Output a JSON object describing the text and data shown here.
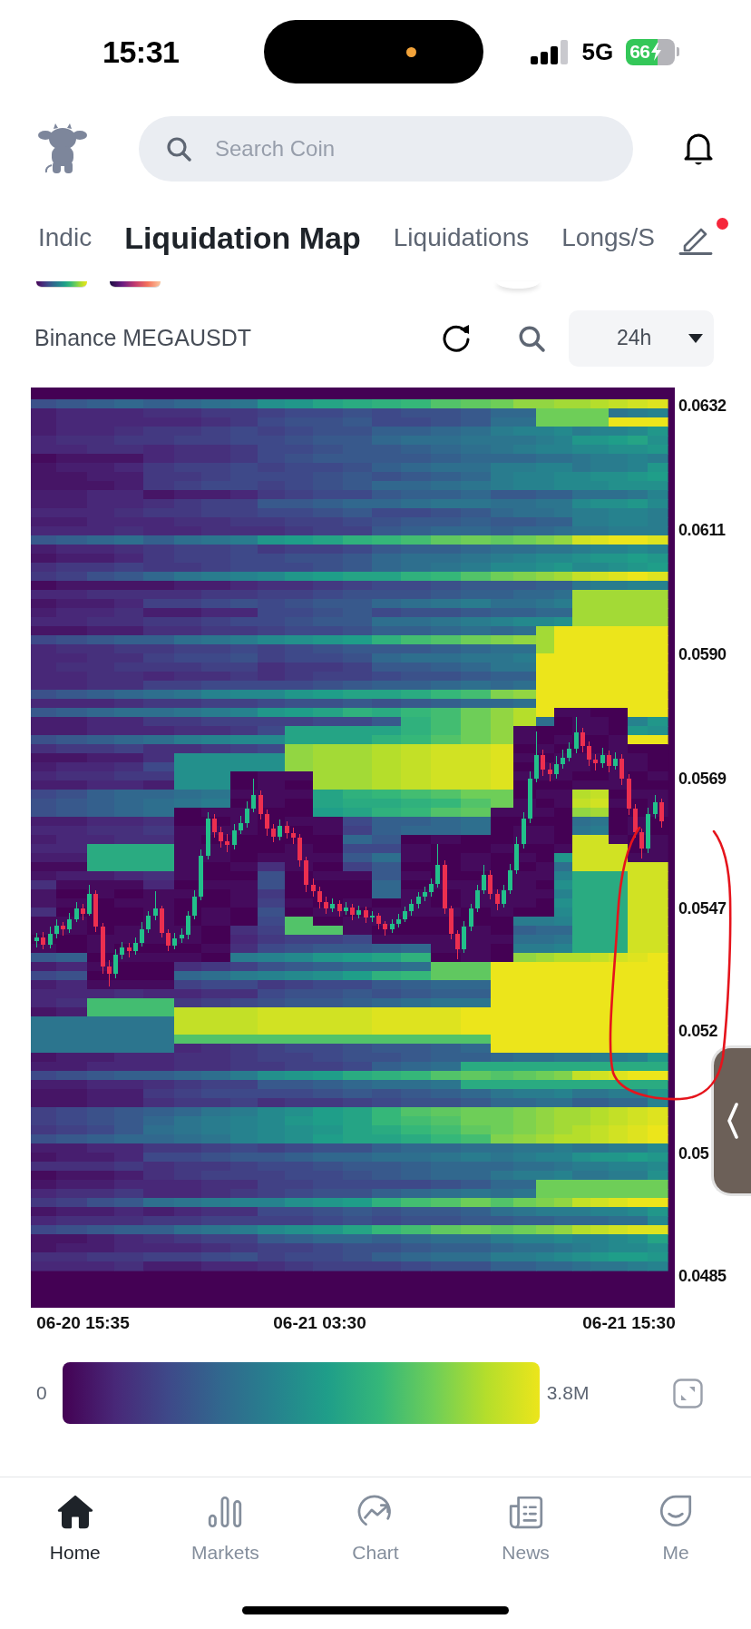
{
  "status_bar": {
    "time": "15:31",
    "network": "5G",
    "battery": "66",
    "charging": true
  },
  "header": {
    "search": {
      "placeholder": "Search Coin"
    }
  },
  "tabs": [
    {
      "label": "Indic",
      "selected": false
    },
    {
      "label": "Liquidation Map",
      "selected": true
    },
    {
      "label": "Liquidations",
      "selected": false
    },
    {
      "label": "Longs/S",
      "selected": false
    }
  ],
  "edit": {
    "notification": true
  },
  "toolbar": {
    "pair": "Binance MEGAUSDT",
    "interval": "24h"
  },
  "chart": {
    "chart_data": {
      "type": "candlestick",
      "categories": [
        null,
        null,
        null,
        null,
        null,
        null,
        null,
        "06-20 15:35",
        null,
        null,
        null,
        null,
        null,
        null,
        null,
        null,
        null,
        null,
        null,
        null,
        null,
        null,
        null,
        null,
        null,
        null,
        null,
        null,
        null,
        null,
        null,
        null,
        null,
        null,
        null,
        null,
        null,
        null,
        null,
        null,
        null,
        null,
        null,
        "06-21 03:30",
        null,
        null,
        null,
        null,
        null,
        null,
        null,
        null,
        null,
        null,
        null,
        null,
        null,
        null,
        null,
        null,
        null,
        null,
        null,
        null,
        null,
        null,
        null,
        null,
        null,
        null,
        null,
        null,
        null,
        null,
        null,
        null,
        null,
        null,
        null,
        null,
        null,
        null,
        null,
        null,
        null,
        null,
        null,
        null,
        null,
        null,
        "06-21 15:30",
        null,
        null,
        null,
        null,
        null
      ],
      "ohlc": [
        [
          0.05415,
          0.0543,
          0.05405,
          0.05422
        ],
        [
          0.05422,
          0.05431,
          0.05402,
          0.0541
        ],
        [
          0.0541,
          0.0544,
          0.05404,
          0.05428
        ],
        [
          0.05428,
          0.05452,
          0.0542,
          0.05441
        ],
        [
          0.05441,
          0.05448,
          0.05425,
          0.05436
        ],
        [
          0.05436,
          0.05463,
          0.0543,
          0.05452
        ],
        [
          0.05452,
          0.05481,
          0.05447,
          0.0547
        ],
        [
          0.0547,
          0.05478,
          0.05451,
          0.05462
        ],
        [
          0.05462,
          0.05511,
          0.05458,
          0.05496
        ],
        [
          0.05496,
          0.05502,
          0.05431,
          0.0544
        ],
        [
          0.0544,
          0.05446,
          0.05361,
          0.05372
        ],
        [
          0.05372,
          0.05384,
          0.05339,
          0.0536
        ],
        [
          0.0536,
          0.05401,
          0.05352,
          0.05392
        ],
        [
          0.05392,
          0.05414,
          0.05385,
          0.05405
        ],
        [
          0.05405,
          0.05412,
          0.05388,
          0.05398
        ],
        [
          0.05398,
          0.05421,
          0.05392,
          0.05412
        ],
        [
          0.05412,
          0.05447,
          0.05406,
          0.05436
        ],
        [
          0.05436,
          0.05466,
          0.0543,
          0.05458
        ],
        [
          0.05458,
          0.055,
          0.05451,
          0.0547
        ],
        [
          0.0547,
          0.05476,
          0.05421,
          0.0543
        ],
        [
          0.0543,
          0.05436,
          0.05398,
          0.05408
        ],
        [
          0.05408,
          0.05429,
          0.05401,
          0.0542
        ],
        [
          0.0542,
          0.05437,
          0.05412,
          0.05426
        ],
        [
          0.05426,
          0.05466,
          0.05419,
          0.05458
        ],
        [
          0.05458,
          0.05501,
          0.05452,
          0.0549
        ],
        [
          0.0549,
          0.05571,
          0.05484,
          0.0556
        ],
        [
          0.0556,
          0.05634,
          0.05553,
          0.05622
        ],
        [
          0.05622,
          0.0563,
          0.0559,
          0.056
        ],
        [
          0.056,
          0.05609,
          0.05574,
          0.05585
        ],
        [
          0.05585,
          0.05596,
          0.05566,
          0.05578
        ],
        [
          0.05578,
          0.05613,
          0.05571,
          0.05602
        ],
        [
          0.05602,
          0.05627,
          0.05596,
          0.05615
        ],
        [
          0.05615,
          0.05652,
          0.05608,
          0.0564
        ],
        [
          0.0564,
          0.0569,
          0.05633,
          0.05662
        ],
        [
          0.05662,
          0.0567,
          0.05621,
          0.0563
        ],
        [
          0.0563,
          0.05638,
          0.05594,
          0.05605
        ],
        [
          0.05605,
          0.05614,
          0.05582,
          0.05592
        ],
        [
          0.05592,
          0.05621,
          0.05586,
          0.0561
        ],
        [
          0.0561,
          0.05618,
          0.05589,
          0.05598
        ],
        [
          0.05598,
          0.05607,
          0.05579,
          0.0559
        ],
        [
          0.0559,
          0.05596,
          0.05541,
          0.05552
        ],
        [
          0.05552,
          0.05558,
          0.05499,
          0.0551
        ],
        [
          0.0551,
          0.05521,
          0.0549,
          0.055
        ],
        [
          0.055,
          0.05508,
          0.05471,
          0.05482
        ],
        [
          0.05482,
          0.05491,
          0.05461,
          0.0547
        ],
        [
          0.0547,
          0.05487,
          0.05464,
          0.05478
        ],
        [
          0.05478,
          0.05484,
          0.05457,
          0.05466
        ],
        [
          0.05466,
          0.05481,
          0.0546,
          0.05472
        ],
        [
          0.05472,
          0.05479,
          0.05451,
          0.0546
        ],
        [
          0.0546,
          0.05476,
          0.05454,
          0.05468
        ],
        [
          0.05468,
          0.05474,
          0.05446,
          0.05455
        ],
        [
          0.05455,
          0.05466,
          0.05448,
          0.05458
        ],
        [
          0.05458,
          0.05463,
          0.05435,
          0.05444
        ],
        [
          0.05444,
          0.0545,
          0.05424,
          0.05436
        ],
        [
          0.05436,
          0.05453,
          0.0543,
          0.05445
        ],
        [
          0.05445,
          0.05461,
          0.05439,
          0.05452
        ],
        [
          0.05452,
          0.05474,
          0.05447,
          0.05466
        ],
        [
          0.05466,
          0.05486,
          0.05459,
          0.05478
        ],
        [
          0.05478,
          0.05499,
          0.05471,
          0.0549
        ],
        [
          0.0549,
          0.05508,
          0.05483,
          0.05498
        ],
        [
          0.05498,
          0.05521,
          0.05491,
          0.05512
        ],
        [
          0.05512,
          0.0558,
          0.05506,
          0.05545
        ],
        [
          0.05545,
          0.05552,
          0.05462,
          0.0547
        ],
        [
          0.0547,
          0.05476,
          0.05418,
          0.05428
        ],
        [
          0.05428,
          0.05434,
          0.05385,
          0.05402
        ],
        [
          0.05402,
          0.05449,
          0.05396,
          0.0544
        ],
        [
          0.0544,
          0.05479,
          0.05433,
          0.0547
        ],
        [
          0.0547,
          0.05511,
          0.05464,
          0.05502
        ],
        [
          0.05502,
          0.05545,
          0.05496,
          0.05528
        ],
        [
          0.05528,
          0.05535,
          0.05486,
          0.05495
        ],
        [
          0.05495,
          0.05503,
          0.05468,
          0.05478
        ],
        [
          0.05478,
          0.05511,
          0.05472,
          0.05502
        ],
        [
          0.05502,
          0.05546,
          0.05495,
          0.05535
        ],
        [
          0.05535,
          0.05592,
          0.05529,
          0.0558
        ],
        [
          0.0558,
          0.05633,
          0.05572,
          0.05622
        ],
        [
          0.05622,
          0.05702,
          0.05615,
          0.0569
        ],
        [
          0.0569,
          0.0577,
          0.05684,
          0.0573
        ],
        [
          0.0573,
          0.05739,
          0.05694,
          0.05705
        ],
        [
          0.05705,
          0.05716,
          0.05686,
          0.05698
        ],
        [
          0.05698,
          0.05728,
          0.0569,
          0.05715
        ],
        [
          0.05715,
          0.05739,
          0.05707,
          0.05726
        ],
        [
          0.05726,
          0.05752,
          0.05719,
          0.0574
        ],
        [
          0.0574,
          0.05795,
          0.05733,
          0.05768
        ],
        [
          0.05768,
          0.05776,
          0.05734,
          0.05745
        ],
        [
          0.05745,
          0.05753,
          0.05711,
          0.05722
        ],
        [
          0.05722,
          0.05731,
          0.05704,
          0.05716
        ],
        [
          0.05716,
          0.05742,
          0.05709,
          0.0573
        ],
        [
          0.0573,
          0.05738,
          0.05701,
          0.05712
        ],
        [
          0.05712,
          0.05735,
          0.05705,
          0.05724
        ],
        [
          0.05724,
          0.05731,
          0.0568,
          0.0569
        ],
        [
          0.0569,
          0.05697,
          0.05629,
          0.0564
        ],
        [
          0.0564,
          0.05647,
          0.0559,
          0.056
        ],
        [
          0.056,
          0.05606,
          0.05555,
          0.05572
        ],
        [
          0.05572,
          0.05641,
          0.05565,
          0.0563
        ],
        [
          0.0563,
          0.05662,
          0.05623,
          0.0565
        ],
        [
          0.0565,
          0.05656,
          0.05608,
          0.05618
        ]
      ],
      "ylim": [
        0.04796,
        0.06351
      ],
      "yticks": [
        {
          "value": 0.0632,
          "label": "0.0632"
        },
        {
          "value": 0.0611,
          "label": "0.0611"
        },
        {
          "value": 0.059,
          "label": "0.0590"
        },
        {
          "value": 0.0569,
          "label": "0.0569"
        },
        {
          "value": 0.0547,
          "label": "0.0547"
        },
        {
          "value": 0.0485,
          "label": "0.0485"
        }
      ]
    },
    "y_axis_cut_labels": [
      "0.052",
      "0.05"
    ]
  },
  "legend": {
    "min": "0",
    "max": "3.8M"
  },
  "nav": [
    {
      "label": "Home",
      "selected": true
    },
    {
      "label": "Markets",
      "selected": false
    },
    {
      "label": "Chart",
      "selected": false
    },
    {
      "label": "News",
      "selected": false
    },
    {
      "label": "Me",
      "selected": false
    }
  ]
}
